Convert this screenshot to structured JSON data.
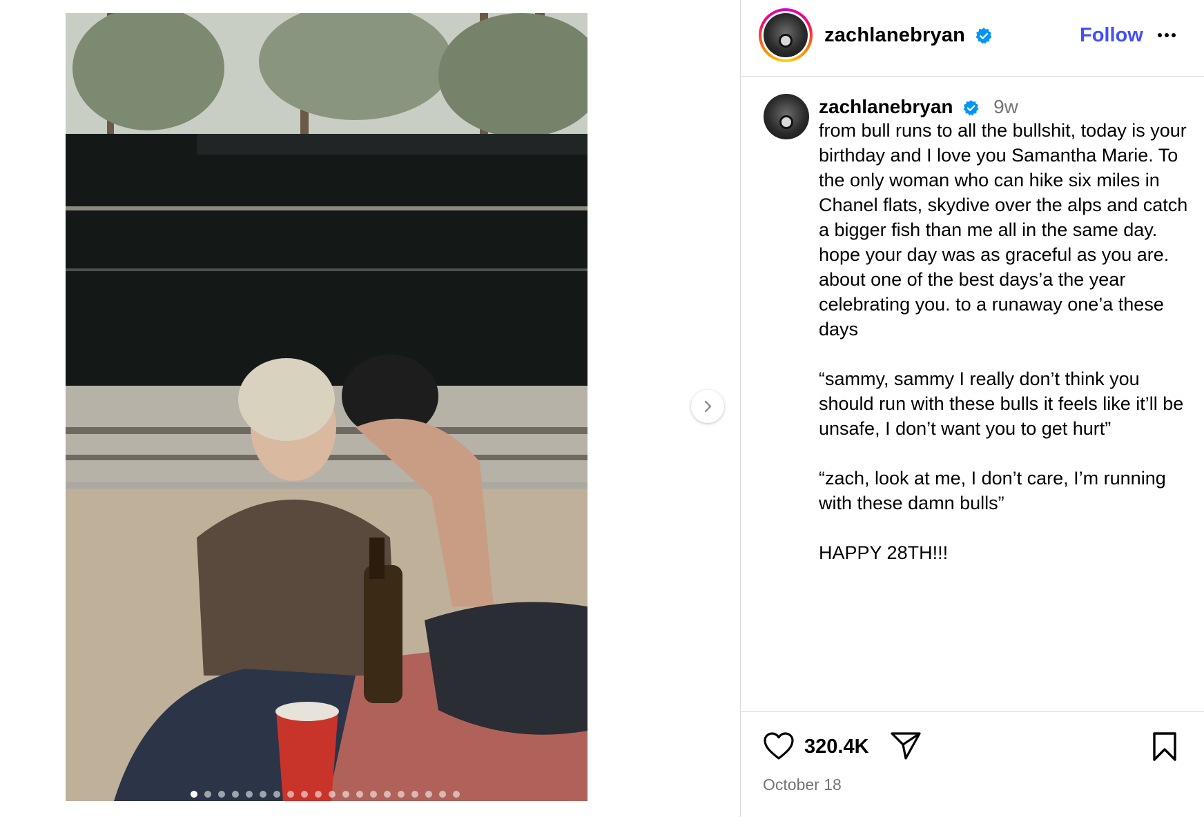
{
  "post": {
    "username": "zachlanebryan",
    "follow_label": "Follow",
    "icons": {
      "verified": "verified-badge-icon",
      "more": "more-options-icon",
      "like": "heart-icon",
      "share": "share-icon",
      "save": "bookmark-icon",
      "next": "chevron-right-icon"
    },
    "caption": {
      "username": "zachlanebryan",
      "time": "9w",
      "text": "from bull runs to all the bullshit, today is your birthday and I love you Samantha Marie. To the only woman who can hike six miles in Chanel flats, skydive over the alps and catch a bigger fish than me all in the same day. hope your day was as graceful as you are. about one of the best days’a the year celebrating you. to a runaway one’a these days\n\n“sammy, sammy I really don’t think you should run with these bulls it feels like it’ll be unsafe, I don’t want you to get hurt”\n\n“zach, look at me, I don’t care, I’m running with these damn bulls”\n\nHAPPY 28TH!!!"
    },
    "likes": "320.4K",
    "date": "October 18",
    "carousel": {
      "total": 20,
      "active_index": 0
    },
    "colors": {
      "accent": "#4150f7",
      "verified": "#0095f6",
      "muted": "#737373",
      "border": "#dbdbdb"
    }
  }
}
